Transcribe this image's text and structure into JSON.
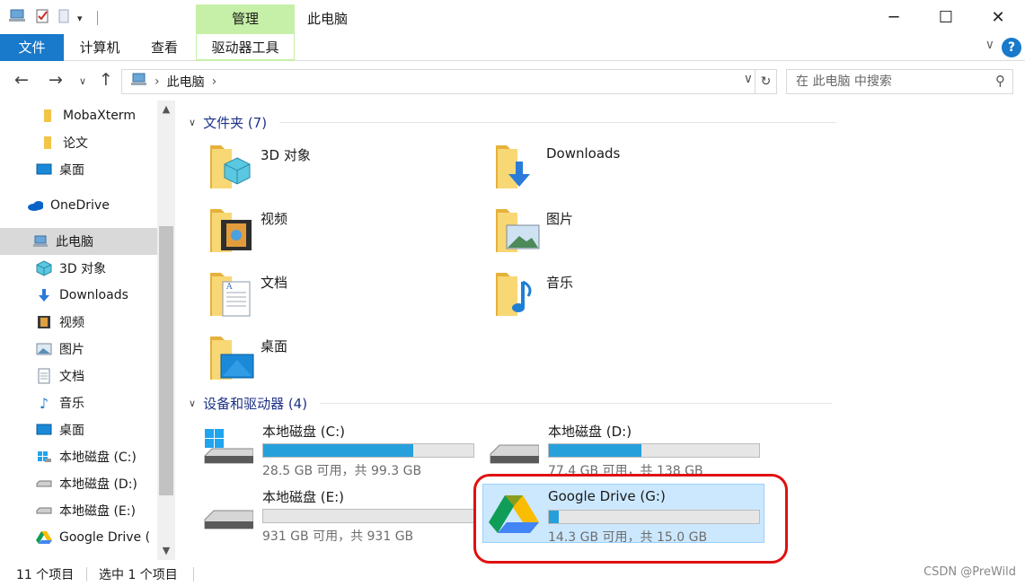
{
  "window": {
    "title": "此电脑",
    "context_tab_header": "管理",
    "buttons": {
      "minimize": "─",
      "maximize": "☐",
      "close": "✕"
    }
  },
  "ribbon": {
    "tabs": [
      {
        "label": "文件",
        "active": true
      },
      {
        "label": "计算机"
      },
      {
        "label": "查看"
      },
      {
        "label": "驱动器工具",
        "contextual": true
      }
    ],
    "help": "?"
  },
  "address": {
    "breadcrumb": [
      "此电脑"
    ],
    "separator": "›"
  },
  "search": {
    "placeholder": "在 此电脑 中搜索"
  },
  "nav_pane": {
    "items": [
      {
        "label": "MobaXterm",
        "icon": "folder-icon"
      },
      {
        "label": "论文",
        "icon": "folder-icon"
      },
      {
        "label": "桌面",
        "icon": "desktop-icon"
      },
      {
        "label": "OneDrive",
        "icon": "onedrive-icon"
      },
      {
        "label": "此电脑",
        "icon": "computer-icon",
        "selected": true
      },
      {
        "label": "3D 对象",
        "icon": "3d-objects-icon"
      },
      {
        "label": "Downloads",
        "icon": "download-icon"
      },
      {
        "label": "视频",
        "icon": "video-icon"
      },
      {
        "label": "图片",
        "icon": "pictures-icon"
      },
      {
        "label": "文档",
        "icon": "documents-icon"
      },
      {
        "label": "音乐",
        "icon": "music-icon"
      },
      {
        "label": "桌面",
        "icon": "desktop-icon"
      },
      {
        "label": "本地磁盘 (C:)",
        "icon": "drive-c-icon"
      },
      {
        "label": "本地磁盘 (D:)",
        "icon": "drive-icon"
      },
      {
        "label": "本地磁盘 (E:)",
        "icon": "drive-icon"
      },
      {
        "label": "Google Drive (",
        "icon": "google-drive-icon"
      }
    ]
  },
  "content": {
    "folders_header": "文件夹 (7)",
    "folders": [
      {
        "label": "3D 对象",
        "icon": "3d-objects-folder-icon"
      },
      {
        "label": "Downloads",
        "icon": "downloads-folder-icon"
      },
      {
        "label": "视频",
        "icon": "videos-folder-icon"
      },
      {
        "label": "图片",
        "icon": "pictures-folder-icon"
      },
      {
        "label": "文档",
        "icon": "documents-folder-icon"
      },
      {
        "label": "音乐",
        "icon": "music-folder-icon"
      },
      {
        "label": "桌面",
        "icon": "desktop-folder-icon"
      }
    ],
    "devices_header": "设备和驱动器 (4)",
    "drives": [
      {
        "name": "本地磁盘 (C:)",
        "info": "28.5 GB 可用，共 99.3 GB",
        "used_fraction": 0.713,
        "icon": "windows-drive-icon"
      },
      {
        "name": "本地磁盘 (D:)",
        "info": "77.4 GB 可用，共 138 GB",
        "used_fraction": 0.439,
        "icon": "hard-drive-icon"
      },
      {
        "name": "本地磁盘 (E:)",
        "info": "931 GB 可用，共 931 GB",
        "used_fraction": 0.0,
        "icon": "hard-drive-icon"
      },
      {
        "name": "Google Drive (G:)",
        "info": "14.3 GB 可用，共 15.0 GB",
        "used_fraction": 0.047,
        "icon": "google-drive-icon",
        "selected": true
      }
    ]
  },
  "status": {
    "count": "11 个项目",
    "selection": "选中 1 个项目"
  },
  "watermark": "CSDN @PreWild",
  "colors": {
    "accent": "#1979ca",
    "context_tab": "#c6efa7",
    "bar_fill": "#26a0da",
    "annotation": "#e01010",
    "selection": "#cce8ff"
  }
}
